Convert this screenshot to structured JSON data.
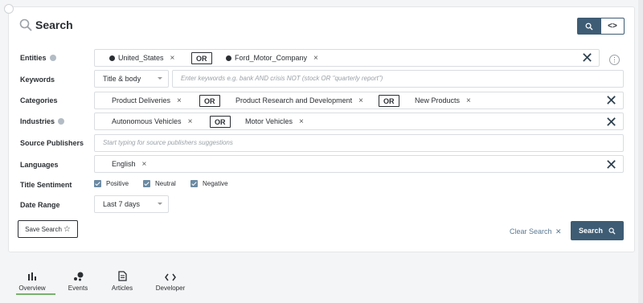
{
  "header": {
    "title": "Search"
  },
  "mode_toggle": {
    "search_icon": "search-icon",
    "code_label": "<>"
  },
  "rows": {
    "entities": {
      "label": "Entities",
      "chips": [
        "United_States",
        "Ford_Motor_Company"
      ],
      "operator": "OR"
    },
    "keywords": {
      "label": "Keywords",
      "scope": "Title & body",
      "placeholder": "Enter keywords e.g. bank AND crisis NOT (stock OR \"quarterly report\")"
    },
    "categories": {
      "label": "Categories",
      "chips": [
        "Product Deliveries",
        "Product Research and Development",
        "New Products"
      ],
      "operator": "OR"
    },
    "industries": {
      "label": "Industries",
      "chips": [
        "Autonomous Vehicles",
        "Motor Vehicles"
      ],
      "operator": "OR"
    },
    "source_publishers": {
      "label": "Source Publishers",
      "placeholder": "Start typing for source publishers suggestions"
    },
    "languages": {
      "label": "Languages",
      "chips": [
        "English"
      ]
    },
    "title_sentiment": {
      "label": "Title Sentiment",
      "options": [
        {
          "label": "Positive",
          "checked": true
        },
        {
          "label": "Neutral",
          "checked": true
        },
        {
          "label": "Negative",
          "checked": true
        }
      ]
    },
    "date_range": {
      "label": "Date Range",
      "value": "Last 7 days"
    }
  },
  "actions": {
    "save_search": "Save Search",
    "clear_search": "Clear Search",
    "search": "Search"
  },
  "tabs": [
    {
      "label": "Overview",
      "icon": "bar-chart-icon",
      "active": true
    },
    {
      "label": "Events",
      "icon": "bubbles-icon",
      "active": false
    },
    {
      "label": "Articles",
      "icon": "document-icon",
      "active": false
    },
    {
      "label": "Developer",
      "icon": "code-icon",
      "active": false
    }
  ],
  "colors": {
    "accent": "#3e5c74",
    "tab_active": "#78b26e",
    "link": "#5b7a93"
  }
}
